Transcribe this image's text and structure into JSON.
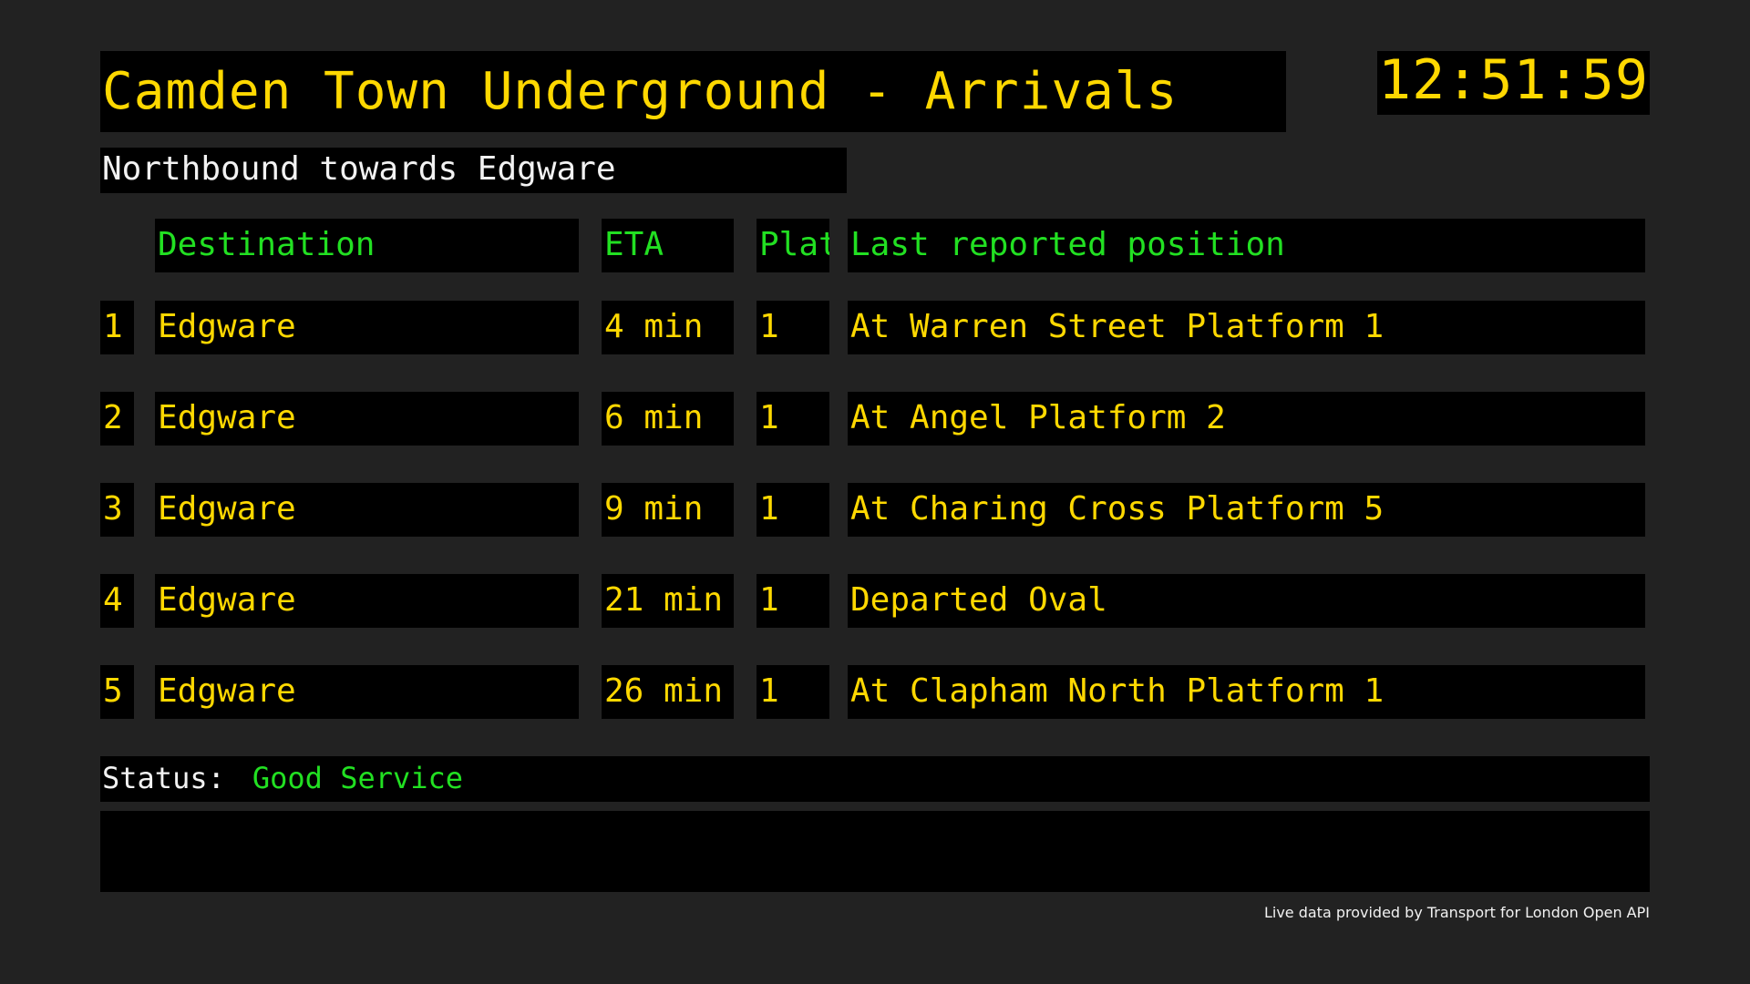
{
  "header": {
    "title": "Camden Town Underground - Arrivals",
    "clock": "12:51:59"
  },
  "direction": "Northbound towards Edgware",
  "table": {
    "columns": {
      "destination": "Destination",
      "eta": "ETA",
      "platform": "Plat",
      "position": "Last reported position"
    },
    "rows": [
      {
        "num": "1",
        "destination": "Edgware",
        "eta": "4 min",
        "platform": "1",
        "position": "At Warren Street Platform 1"
      },
      {
        "num": "2",
        "destination": "Edgware",
        "eta": "6 min",
        "platform": "1",
        "position": "At Angel Platform 2"
      },
      {
        "num": "3",
        "destination": "Edgware",
        "eta": "9 min",
        "platform": "1",
        "position": "At Charing Cross Platform 5"
      },
      {
        "num": "4",
        "destination": "Edgware",
        "eta": "21 min",
        "platform": "1",
        "position": "Departed Oval"
      },
      {
        "num": "5",
        "destination": "Edgware",
        "eta": "26 min",
        "platform": "1",
        "position": "At Clapham North Platform 1"
      }
    ]
  },
  "status": {
    "label": "Status:",
    "value": "Good Service"
  },
  "message": "",
  "footer": {
    "attribution": "Live data provided by Transport for London Open API"
  },
  "colors": {
    "background": "#222222",
    "panel": "#000000",
    "primary_text": "#ffd800",
    "header_text": "#22e022",
    "secondary_text": "#f2f2f2"
  }
}
